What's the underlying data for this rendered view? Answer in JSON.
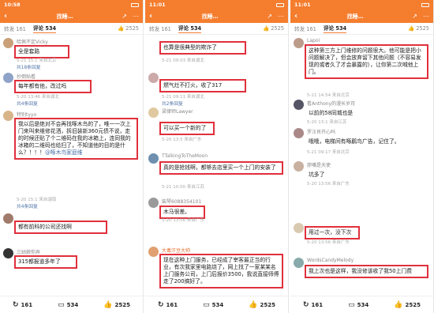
{
  "panels": [
    {
      "status_time": "10:58",
      "title": "找睡…",
      "tab_repost": "转发 161",
      "tab_comments": "评论 534",
      "like_count": "2525",
      "comments": [
        {
          "name": "哈佩不定Vicky",
          "text": "全是套路",
          "date": "5-21 15:1 来自北京",
          "expand": "共18条回复"
        },
        {
          "name": "抄倒贴看",
          "text": "每年都有他，改过吗",
          "date": "5-20 13:46 来自湖北",
          "expand": "共4条回复"
        },
        {
          "name": "特别tyyo",
          "text": "我以后是绝对不会再找啄木鸟的了，唯一一次上门来叫来维修花洒，拆旧装新360元债不说，走的时候还贴了个二维码在我的冰箱上，连同我的冰箱的二维码也给扫了，不知道他的目的是什么？！！！",
          "mention": "@啄木鸟家庭维",
          "date": "5-20 15:1 来自湖南",
          "expand": "共4条回复"
        },
        {
          "name": "-",
          "text": "都有前科的公司还找啊",
          "date": "",
          "expand": ""
        },
        {
          "name": "三姑娘你弄",
          "text": "315都报道多年了",
          "date": "",
          "expand": ""
        }
      ],
      "bottom_repost": "161",
      "bottom_comments": "534",
      "bottom_likes": "2525"
    },
    {
      "status_time": "11:01",
      "title": "找睡…",
      "tab_repost": "转发 161",
      "tab_comments": "评论 534",
      "like_count": "2525",
      "comments": [
        {
          "name": "",
          "text": "也算是很典型的欺诈了",
          "date": "5-21 09:03 来自湖北",
          "expand": ""
        },
        {
          "name": "",
          "text": "燃气灶不打火，收了317",
          "date": "5-21 09:11 来自湖北",
          "expand": "共2条回复"
        },
        {
          "name": "梁律师Lawyer",
          "text": "可以买一个新的了",
          "date": "5-20 13:5 来自广东",
          "expand": ""
        },
        {
          "name": "TTalkingToTheMoon",
          "text": "真的是抢钱啊，都够去店里买一个上门的安装了",
          "date": "5-21 10:00 来自江苏",
          "expand": ""
        },
        {
          "name": "柴琴6088354101",
          "text": "木马很差。",
          "date": "5-20 13:56 来自广东",
          "expand": ""
        },
        {
          "name": "大毒汗豆大帅",
          "text": "现在这种上门服务，已经成了宰客最正当的行业，有次我家里电路烧了，网上找了一家某某名上门服务公司，上门后报价3500，我说直接师傅走了200搞好了。",
          "date": "",
          "expand": ""
        }
      ],
      "bottom_repost": "161",
      "bottom_comments": "534",
      "bottom_likes": "2525"
    },
    {
      "status_time": "11:01",
      "title": "找睡…",
      "tab_repost": "转发 161",
      "tab_comments": "评论 534",
      "like_count": "2525",
      "comments": [
        {
          "name": "Lapoi",
          "text": "这种第三方上门维修的问题很大。他可能是把小问题解决了，但会放弃留下其他问题（不容易发现的或者久了才会暴露的），让你第二次喊他上门。",
          "date": "5-21 14:54 来自北京",
          "expand": ""
        },
        {
          "name": "看Anthony的漫长岁月",
          "text": "以前的58同城也是",
          "date": "5-20 13:1 来自江苏",
          "expand": ""
        },
        {
          "name": "罗汪肖开心吗",
          "text": "哦哦，电梯间有啄鹛鸟广告，记住了。",
          "date": "5-21 09:17 来自北京",
          "expand": ""
        },
        {
          "name": "廖嘴是天使",
          "text": "坑多了",
          "date": "5-20 13:56 来自广东",
          "expand": ""
        },
        {
          "name": "",
          "text": "用过一次，没下次",
          "date": "5-20 13:56 来自广东",
          "expand": ""
        },
        {
          "name": "WordsCandyMelody",
          "text": "我上次也是这样，我没修该收了我50上门费",
          "date": "",
          "expand": ""
        }
      ],
      "bottom_repost": "161",
      "bottom_comments": "534",
      "bottom_likes": "2525"
    }
  ]
}
